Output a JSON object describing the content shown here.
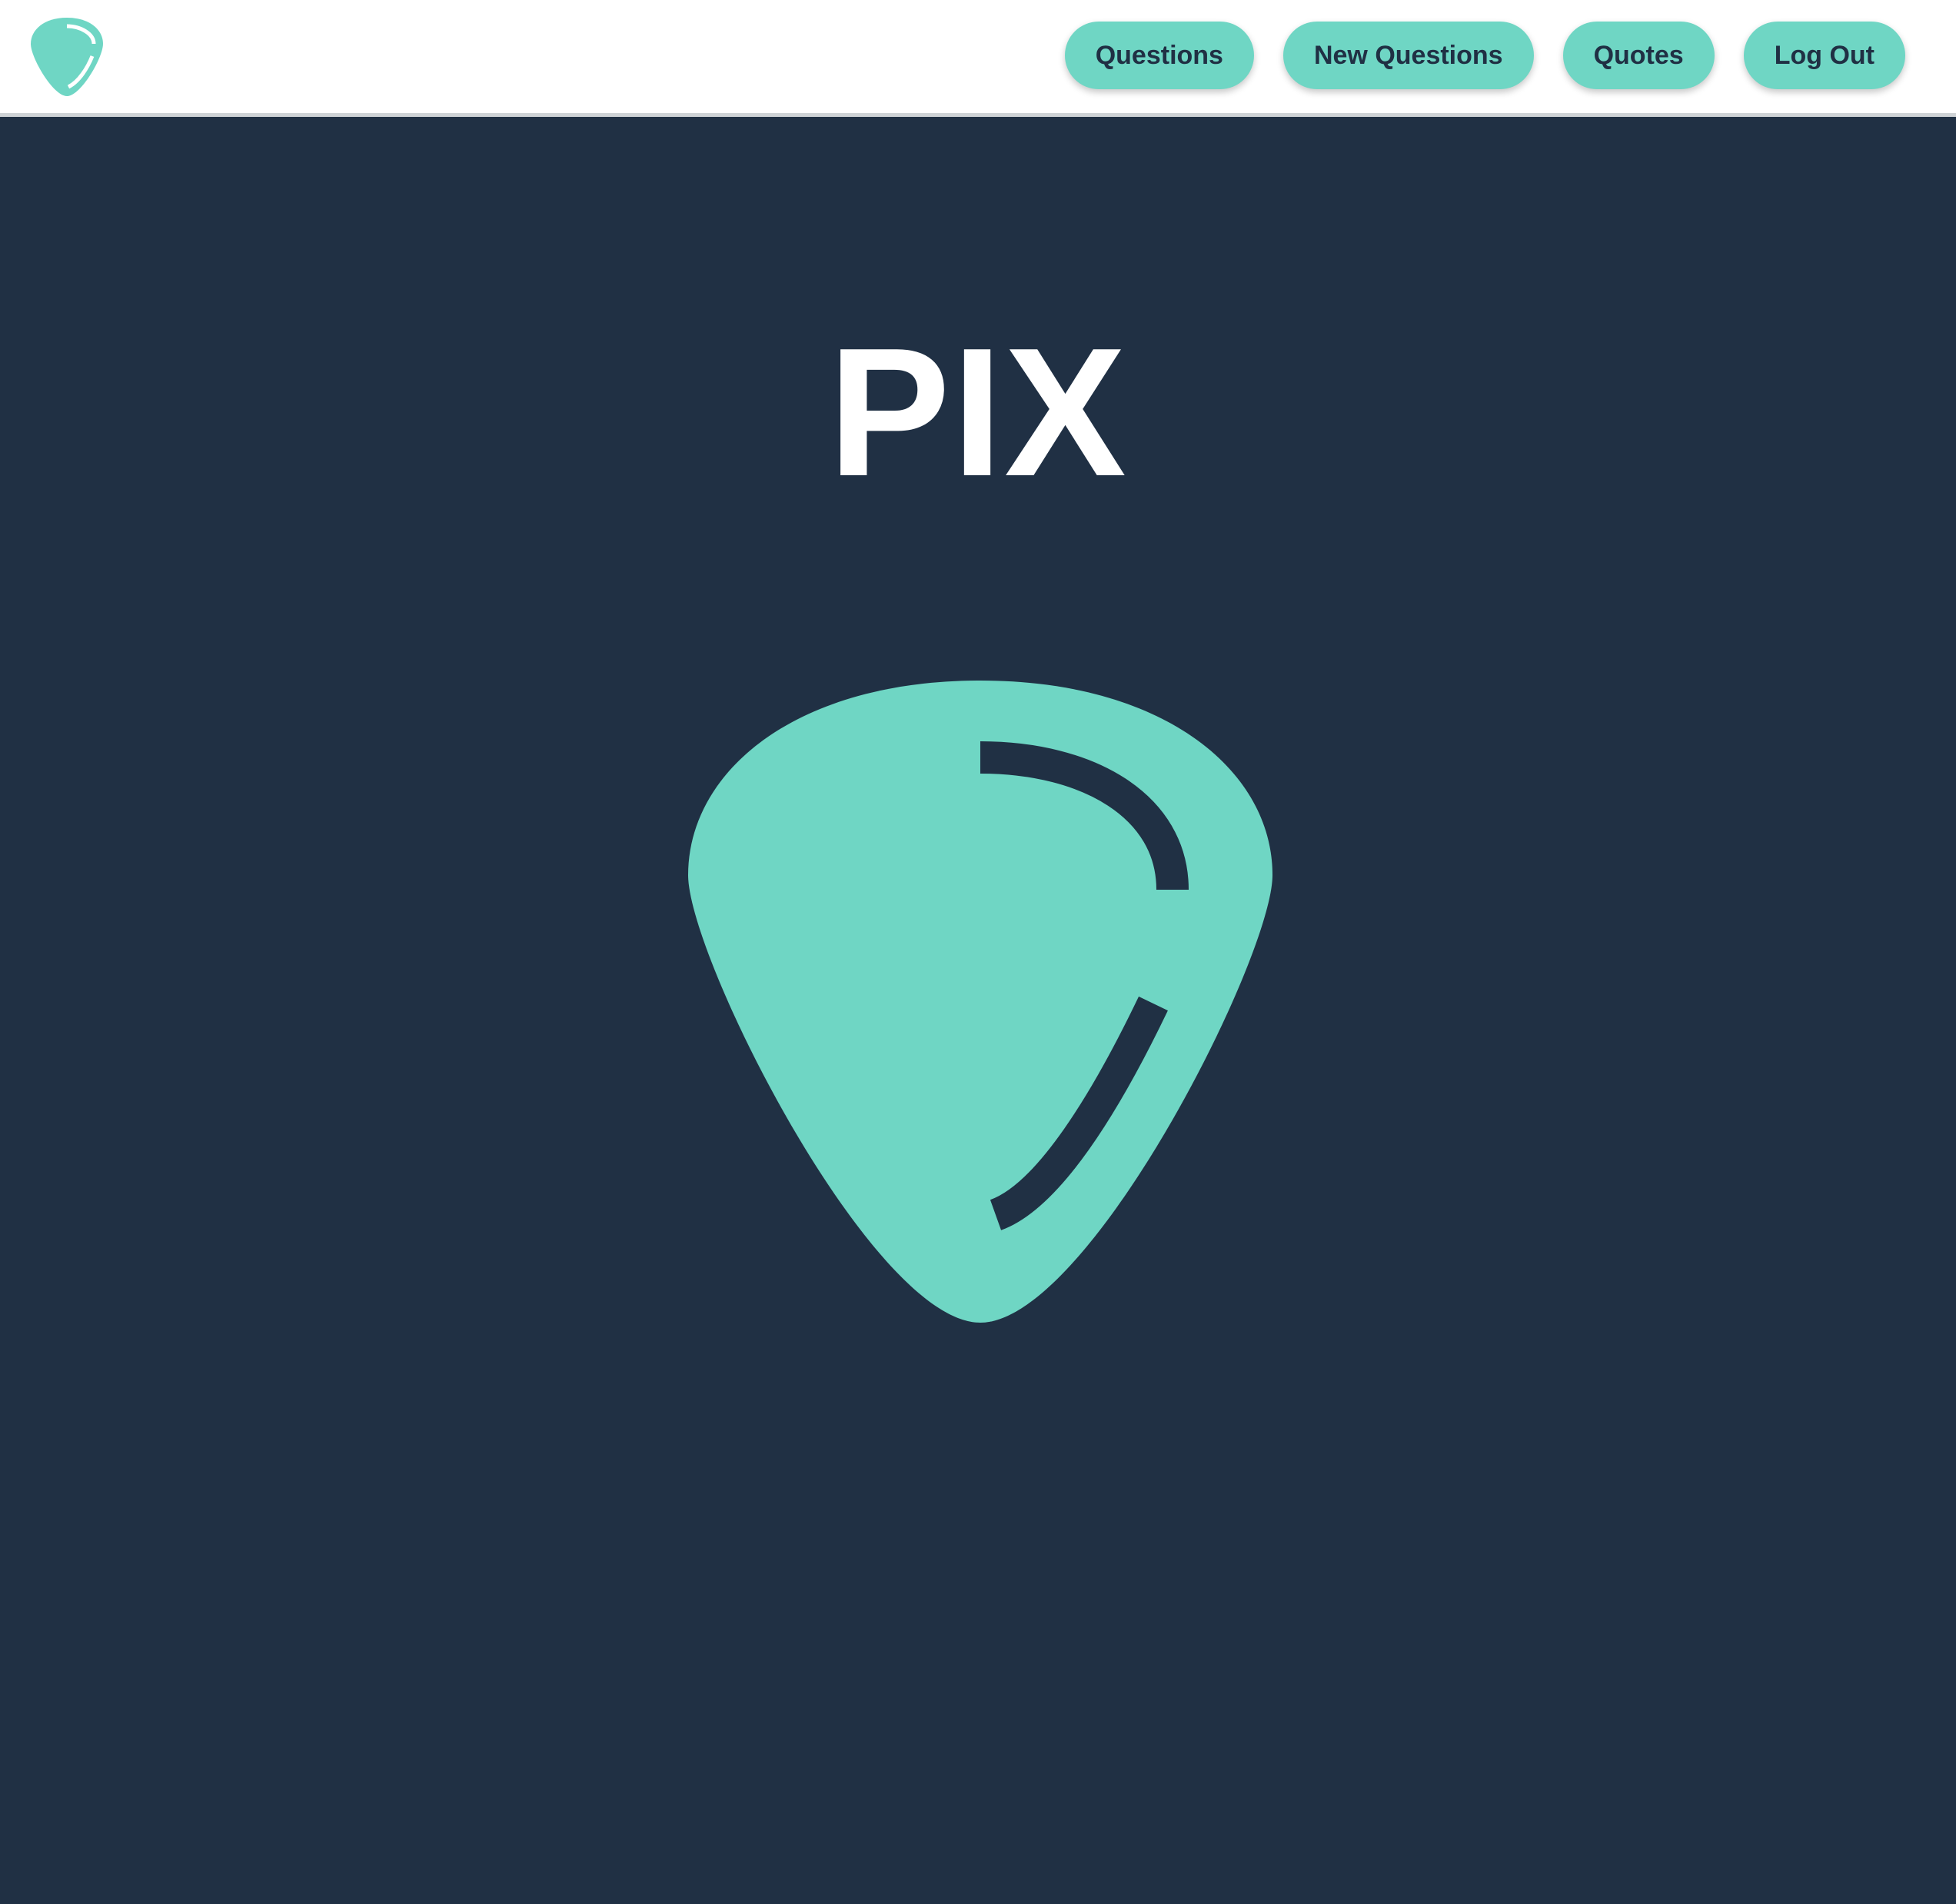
{
  "header": {
    "logo_icon": "guitar-pick-icon",
    "nav": [
      {
        "label": "Questions"
      },
      {
        "label": "New Questions"
      },
      {
        "label": "Quotes"
      },
      {
        "label": "Log Out"
      }
    ]
  },
  "hero": {
    "title": "PIX",
    "logo_icon": "guitar-pick-icon"
  },
  "colors": {
    "accent": "#6fd6c4",
    "background": "#203044",
    "header_background": "#ffffff",
    "button_text": "#203044",
    "title_text": "#ffffff"
  }
}
